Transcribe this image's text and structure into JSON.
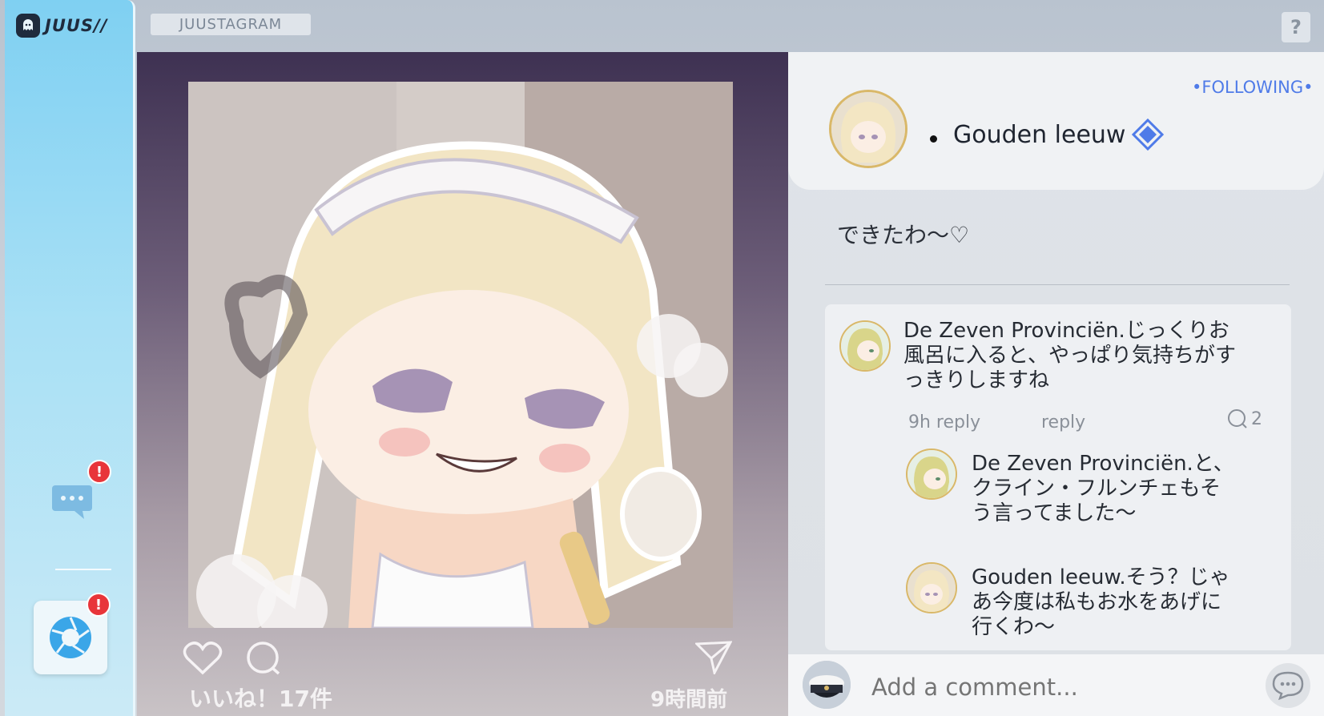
{
  "app": {
    "brand": "JUUS//",
    "tab_title": "JUUSTAGRAM",
    "help_label": "?"
  },
  "sidebar": {
    "chat_badge": "!",
    "camera_badge": "!"
  },
  "post": {
    "like_count": "いいね！17件",
    "time": "9時間前"
  },
  "profile": {
    "name": "Gouden leeuw",
    "following_label": "•FOLLOWING•",
    "caption": "できたわ〜♡"
  },
  "comments": [
    {
      "author": "De Zeven Provinciën.",
      "line1": "じっくりお",
      "line2": "風呂に入ると、やっぱり気持ちがす",
      "line3": "っきりしますね",
      "time_reply": "9h reply",
      "reply_label": "reply",
      "reply_count": "2"
    },
    {
      "author": "De Zeven Provinciën.",
      "line1": "と、",
      "line2": "クライン・フルンチェもそ",
      "line3": "う言ってました〜"
    },
    {
      "author": "Gouden leeuw.",
      "line1": "そう？じゃ",
      "line2": "あ今度は私もお水をあげに",
      "line3": "行くわ〜"
    }
  ],
  "comment_bar": {
    "placeholder": "Add a comment..."
  },
  "colors": {
    "accent": "#4f7be8",
    "badge": "#e8353a",
    "sidebar": "#7fd0f2"
  }
}
